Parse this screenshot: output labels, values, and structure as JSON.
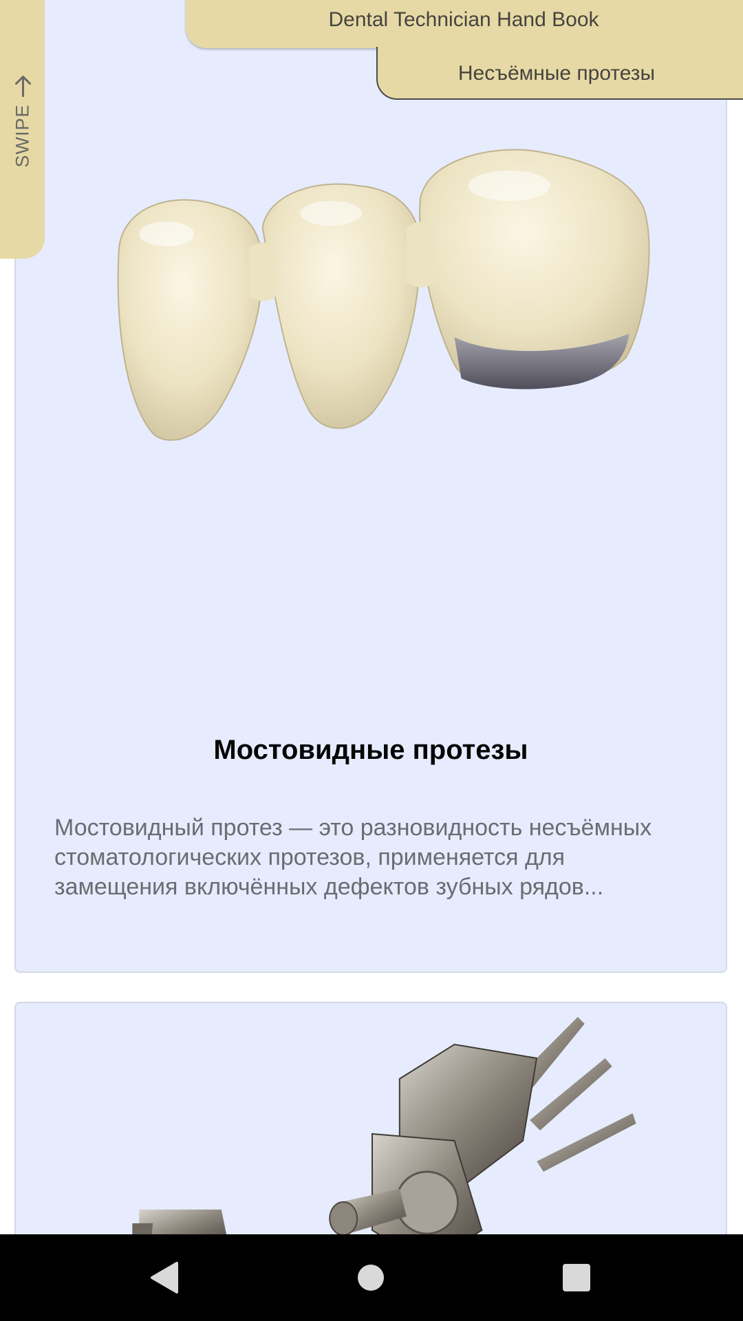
{
  "header": {
    "app_title": "Dental Technician Hand Book",
    "section_title": "Несъёмные протезы"
  },
  "swipe_hint": "SWIPE",
  "cards": [
    {
      "title": "Мостовидные протезы",
      "description": "Мостовидный протез — это разновидность несъёмных стоматологических протезов, применяется для замещения включённых дефектов зубных рядов...",
      "image": "dental-bridge-image"
    },
    {
      "title": "",
      "description": "",
      "image": "metal-attachment-image"
    }
  ],
  "nav": {
    "back_icon": "triangle-back-icon",
    "home_icon": "circle-home-icon",
    "recent_icon": "square-recents-icon"
  },
  "colors": {
    "card_bg": "#e6ecfd",
    "tab_bg": "#e6d9a5",
    "nav_bg": "#000000"
  }
}
